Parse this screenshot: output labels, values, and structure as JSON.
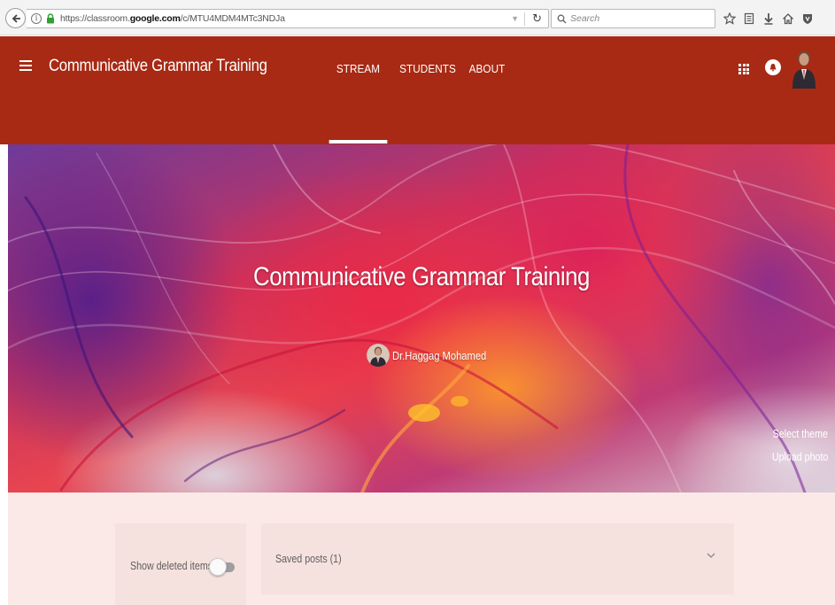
{
  "browser": {
    "url_prefix": "https://classroom.",
    "url_domain": "google.com",
    "url_path": "/c/MTU4MDM4MTc3NDJa",
    "search_placeholder": "Search"
  },
  "app": {
    "class_title": "Communicative Grammar Training",
    "accent_color": "#a82a14",
    "tabs": [
      {
        "label": "STREAM",
        "active": true
      },
      {
        "label": "STUDENTS",
        "active": false
      },
      {
        "label": "ABOUT",
        "active": false
      }
    ]
  },
  "banner": {
    "title": "Communicative Grammar Training",
    "teacher_name": "Dr.Haggag Mohamed",
    "select_theme": "Select theme",
    "upload_photo": "Upload photo"
  },
  "stream": {
    "show_deleted_label": "Show deleted items",
    "show_deleted_enabled": false,
    "saved_posts_label": "Saved posts (1)"
  }
}
